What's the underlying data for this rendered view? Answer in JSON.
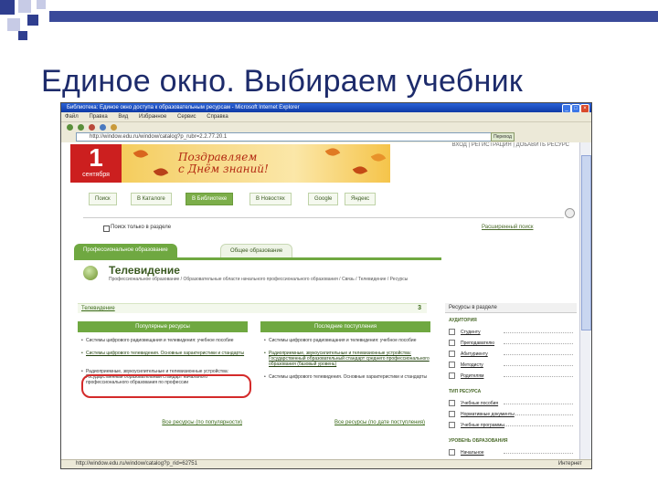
{
  "slide": {
    "title": "Единое окно. Выбираем учебник"
  },
  "browser": {
    "title": "Библиотека: Единое окно доступа к образовательным ресурсам - Microsoft Internet Explorer",
    "menu": [
      "Файл",
      "Правка",
      "Вид",
      "Избранное",
      "Сервис",
      "Справка"
    ],
    "address": "http://window.edu.ru/window/catalog?p_rubr=2.2.77.20.1",
    "go_label": "Переход",
    "status_url": "http://window.edu.ru/window/catalog?p_rid=62751",
    "status_zone": "Интернет"
  },
  "header": {
    "top_links": "ВХОД | РЕГИСТРАЦИЯ | ДОБАВИТЬ РЕСУРС",
    "banner": {
      "day": "1",
      "month": "сентября",
      "line1": "Поздравляем",
      "line2": "с Днём знаний!"
    }
  },
  "nav_tabs": [
    {
      "label": "Поиск",
      "active": false
    },
    {
      "label": "В Каталоге",
      "active": false
    },
    {
      "label": "В Библиотеке",
      "active": true
    },
    {
      "label": "В Новостях",
      "active": false
    },
    {
      "label": "Google",
      "active": false
    },
    {
      "label": "Яндекс",
      "active": false
    }
  ],
  "search": {
    "checkbox_label": "Поиск только в разделе",
    "advanced_link": "Расширенный поиск"
  },
  "content_tabs": {
    "active": "Профессиональное образование",
    "inactive": "Общее образование"
  },
  "section": {
    "title": "Телевидение",
    "description": "Профессиональное образование / Образовательные области начального профессионального образования / Связь / Телевидение / Ресурсы",
    "category_link": "Телевидение",
    "category_count": "3"
  },
  "popular": {
    "header": "Популярные ресурсы",
    "items": [
      "Системы цифрового радиовещания и телевидения: учебное пособие",
      "Системы цифрового телевидения. Основные характеристики и стандарты",
      "Радиоприемные, звукоусилительные и телевизионные устройства: Государственный образовательный стандарт начального профессионального образования по профессии"
    ],
    "all_link": "Все ресурсы (по популярности)"
  },
  "latest": {
    "header": "Последние поступления",
    "items": [
      "Системы цифрового радиовещания и телевидения: учебное пособие",
      "Радиоприемные, звукоусилительные и телевизионные устройства: Государственный образовательный стандарт среднего профессионального образования (базовый уровень)",
      "Системы цифрового телевидения. Основные характеристики и стандарты"
    ],
    "all_link": "Все ресурсы (по дате поступления)"
  },
  "right_panel": {
    "header": "Ресурсы в разделе",
    "sections": [
      {
        "title": "АУДИТОРИЯ",
        "items": [
          "Студенту",
          "Преподавателю",
          "Абитуриенту",
          "Методисту",
          "Родителям"
        ]
      },
      {
        "title": "ТИП РЕСУРСА",
        "items": [
          "Учебные пособия",
          "Нормативные документы",
          "Учебные программы"
        ]
      },
      {
        "title": "УРОВЕНЬ ОБРАЗОВАНИЯ",
        "items": [
          "Начальное"
        ]
      }
    ]
  },
  "colors": {
    "accent_green": "#6fa841",
    "slide_title": "#1d2b6b",
    "highlight_ring": "#d42a2a"
  }
}
